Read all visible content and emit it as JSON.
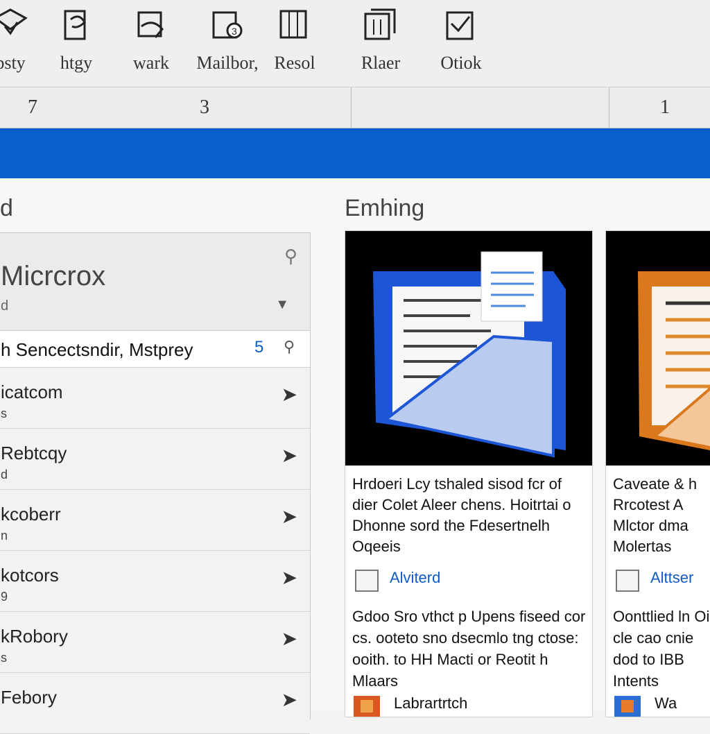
{
  "ribbon": {
    "buttons": [
      {
        "label": "bsty",
        "icon": "envelope-edit-icon"
      },
      {
        "label": "htgy",
        "icon": "page-tool-icon"
      },
      {
        "label": "wark",
        "icon": "hand-edit-icon"
      },
      {
        "label": "Mailbor,",
        "icon": "page-badge-icon"
      },
      {
        "label": "Resol",
        "icon": "page-list-icon"
      },
      {
        "label": "Rlaer",
        "icon": "page-stack-icon"
      },
      {
        "label": "Otiok",
        "icon": "page-check-icon"
      }
    ]
  },
  "numbers": [
    "7",
    "3",
    "1"
  ],
  "left": {
    "heading": "d",
    "title": "Micrcrox",
    "subtitle": "d",
    "search_text": "h Sencectsndir, Mstprey",
    "search_num": "5",
    "rows": [
      {
        "title": "icatcom",
        "sub": "s"
      },
      {
        "title": "Rebtcqy",
        "sub": "d"
      },
      {
        "title": "kcoberr",
        "sub": "n"
      },
      {
        "title": "kotcors",
        "sub": "9"
      },
      {
        "title": "kRobory",
        "sub": "s"
      },
      {
        "title": "Febory",
        "sub": ""
      }
    ]
  },
  "right": {
    "heading": "Emhing",
    "cards": [
      {
        "desc": "Hrdoeri Lcy tshaled sisod fcr of dier Colet Aleer chens. Hoitrtai o Dhonne sord the Fdesertnelh Oqeeis",
        "link": "Alviterd",
        "desc2": "Gdoo Sro vthct p Upens fiseed cor cs. ooteto sno dsecmlo tng ctose: ooith. to HH Macti or Reotit h Mlaars",
        "foot": "Labrartrtch"
      },
      {
        "desc": "Caveate & h Rrcotest A Mlctor dma Molertas",
        "link": "Alttser",
        "desc2": "Oonttlied ln Oie cle cao cnie dod to IBB Intents",
        "foot": "Wa"
      }
    ]
  },
  "colors": {
    "accent": "#0b5fcc",
    "orange": "#e08a2c"
  }
}
